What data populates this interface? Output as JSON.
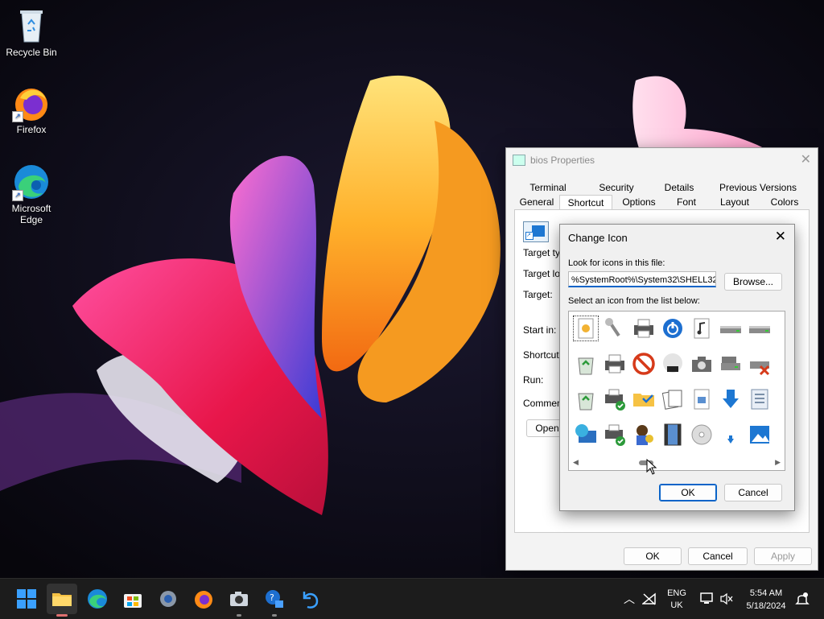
{
  "desktop": {
    "icons": [
      {
        "label": "Recycle Bin",
        "icon": "recycle-bin-icon"
      },
      {
        "label": "Firefox",
        "icon": "firefox-icon"
      },
      {
        "label": "Microsoft Edge",
        "icon": "edge-icon"
      }
    ]
  },
  "props_window": {
    "title": "bios Properties",
    "tabs_row1": [
      "Terminal",
      "Security",
      "Details",
      "Previous Versions"
    ],
    "tabs_row2": [
      "General",
      "Shortcut",
      "Options",
      "Font",
      "Layout",
      "Colors"
    ],
    "active_tab": "Shortcut",
    "labels": {
      "target_type": "Target typ",
      "target_location": "Target loc",
      "target": "Target:",
      "start_in": "Start in:",
      "shortcut_key": "Shortcut k",
      "run": "Run:",
      "comment": "Comment:"
    },
    "open_button": "Open",
    "ok": "OK",
    "cancel": "Cancel",
    "apply": "Apply"
  },
  "change_icon": {
    "title": "Change Icon",
    "look_label": "Look for icons in this file:",
    "path_value": "%SystemRoot%\\System32\\SHELL32",
    "browse": "Browse...",
    "select_label": "Select an icon from the list below:",
    "ok": "OK",
    "cancel": "Cancel",
    "icons": [
      "file-shortcut-icon",
      "key-icon",
      "printer-icon",
      "power-icon",
      "music-file-icon",
      "drive-icon",
      "drive-icon",
      "orange-ball-icon",
      "recycle-bin-full-icon",
      "printer-icon",
      "no-entry-icon",
      "dvd-icon",
      "camera-icon",
      "network-drive-icon",
      "disconnected-drive-icon",
      "purple-bar-icon",
      "recycle-bin-full-icon",
      "shared-printer-icon",
      "folder-check-icon",
      "documents-icon",
      "media-file-icon",
      "download-icon",
      "document-icon",
      "partial-icon",
      "network-globe-icon",
      "shared-printer-icon",
      "user-key-icon",
      "film-icon",
      "cd-icon",
      "download-small-icon",
      "picture-icon",
      "chevron-partial-icon"
    ]
  },
  "taskbar": {
    "apps": [
      "start-icon",
      "file-explorer-icon",
      "edge-icon",
      "store-icon",
      "settings-icon",
      "firefox-icon",
      "camera-icon",
      "help-icon",
      "undo-icon"
    ],
    "lang_top": "ENG",
    "lang_bottom": "UK",
    "time": "5:54 AM",
    "date": "5/18/2024"
  }
}
